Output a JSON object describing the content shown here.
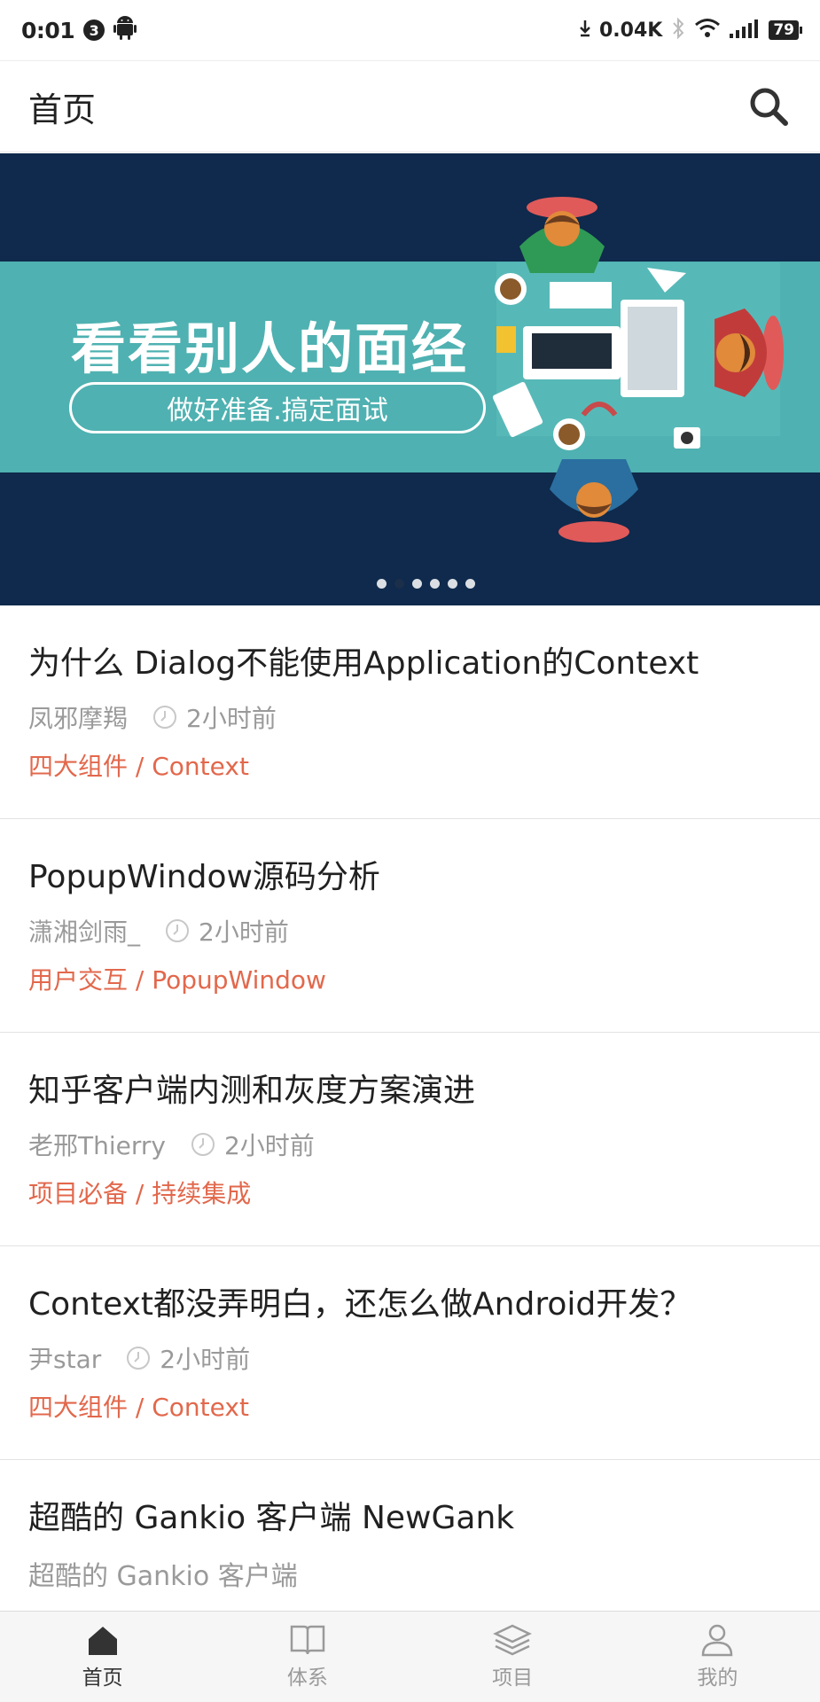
{
  "status_bar": {
    "time": "0:01",
    "notification_count": "3",
    "net_speed": "0.04K",
    "battery": "79"
  },
  "app_bar": {
    "title": "首页"
  },
  "banner": {
    "headline": "看看别人的面经",
    "subline": "做好准备.搞定面试",
    "dots": 6,
    "active_dot": 1,
    "colors": {
      "navy": "#0f2a4c",
      "teal": "#4fb1b1"
    }
  },
  "articles": [
    {
      "title": "为什么 Dialog不能使用Application的Context",
      "author": "凤邪摩羯",
      "time": "2小时前",
      "tags": "四大组件 / Context"
    },
    {
      "title": "PopupWindow源码分析",
      "author": "潇湘剑雨_",
      "time": "2小时前",
      "tags": "用户交互 / PopupWindow"
    },
    {
      "title": "知乎客户端内测和灰度方案演进",
      "author": "老邢Thierry",
      "time": "2小时前",
      "tags": "项目必备 / 持续集成"
    },
    {
      "title": "Context都没弄明白，还怎么做Android开发？",
      "author": "尹star",
      "time": "2小时前",
      "tags": "四大组件 / Context"
    },
    {
      "title": "超酷的 Gankio 客户端 NewGank",
      "desc": "超酷的 Gankio 客户端"
    }
  ],
  "bottom_nav": [
    {
      "label": "首页",
      "icon": "home-icon",
      "active": true
    },
    {
      "label": "体系",
      "icon": "book-icon",
      "active": false
    },
    {
      "label": "项目",
      "icon": "layers-icon",
      "active": false
    },
    {
      "label": "我的",
      "icon": "person-icon",
      "active": false
    }
  ],
  "colors": {
    "accent_tag": "#e2684c",
    "meta_gray": "#9a9a9a"
  }
}
